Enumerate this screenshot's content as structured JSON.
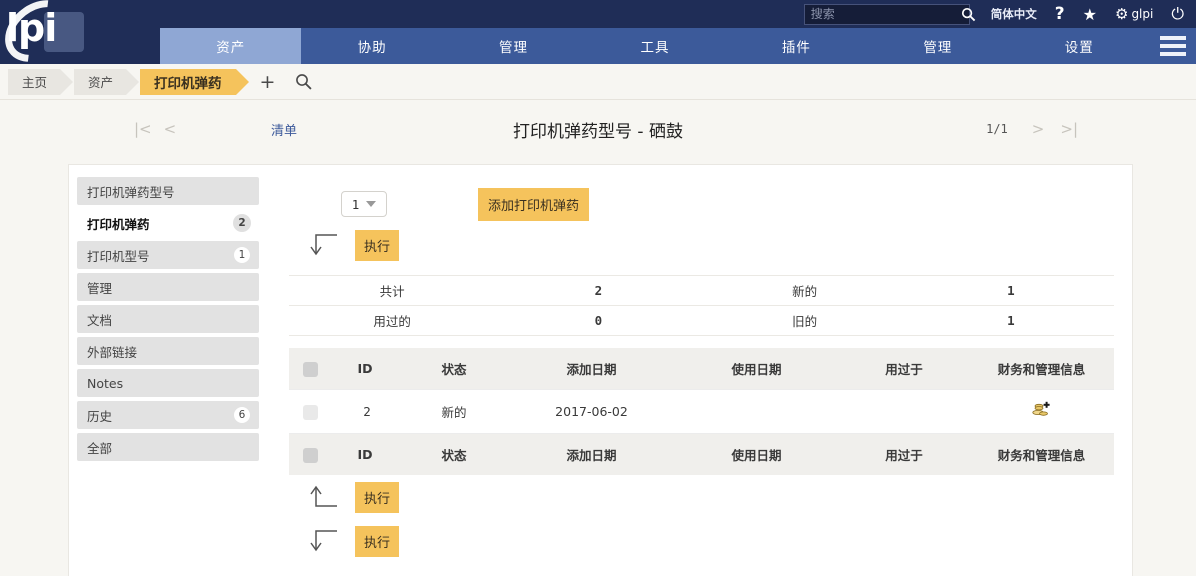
{
  "header": {
    "search_placeholder": "搜索",
    "search_value": "",
    "language": "简体中文",
    "help_label": "?",
    "star_label": "★",
    "user_label": "glpi",
    "power_label": "⏻",
    "logo_text": "lpi"
  },
  "nav": {
    "items": [
      {
        "label": "资产",
        "active": true
      },
      {
        "label": "协助",
        "active": false
      },
      {
        "label": "管理",
        "active": false
      },
      {
        "label": "工具",
        "active": false
      },
      {
        "label": "插件",
        "active": false
      },
      {
        "label": "管理",
        "active": false
      },
      {
        "label": "设置",
        "active": false
      }
    ]
  },
  "breadcrumb": {
    "items": [
      {
        "label": "主页",
        "current": false
      },
      {
        "label": "资产",
        "current": false
      },
      {
        "label": "打印机弹药",
        "current": true
      }
    ],
    "add_icon": "+",
    "search_icon": "search-icon"
  },
  "pagehead": {
    "first_icon": "|<",
    "prev_icon": "<",
    "list_label": "清单",
    "title": "打印机弹药型号 - 硒鼓",
    "counter": "1/1",
    "next_icon": ">",
    "last_icon": ">|"
  },
  "sidebar": {
    "items": [
      {
        "label": "打印机弹药型号",
        "badge": "",
        "active": false
      },
      {
        "label": "打印机弹药",
        "badge": "2",
        "active": true
      },
      {
        "label": "打印机型号",
        "badge": "1",
        "active": false
      },
      {
        "label": "管理",
        "badge": "",
        "active": false
      },
      {
        "label": "文档",
        "badge": "",
        "active": false
      },
      {
        "label": "外部链接",
        "badge": "",
        "active": false
      },
      {
        "label": "Notes",
        "badge": "",
        "active": false
      },
      {
        "label": "历史",
        "badge": "6",
        "active": false
      },
      {
        "label": "全部",
        "badge": "",
        "active": false
      }
    ]
  },
  "toolbar": {
    "count_value": "1",
    "add_label": "添加打印机弹药",
    "exec_top_label": "执行",
    "exec_bottom_up_label": "执行",
    "exec_bottom_down_label": "执行"
  },
  "stats": {
    "rows": [
      {
        "label1": "共计",
        "value1": "2",
        "label2": "新的",
        "value2": "1"
      },
      {
        "label1": "用过的",
        "value1": "0",
        "label2": "旧的",
        "value2": "1"
      }
    ]
  },
  "table": {
    "columns": [
      "ID",
      "状态",
      "添加日期",
      "使用日期",
      "用过于",
      "财务和管理信息"
    ],
    "rows": [
      {
        "id": "2",
        "state": "新的",
        "added": "2017-06-02",
        "used": "",
        "used_on": "",
        "finance_icon": "add-money-icon"
      }
    ]
  },
  "colors": {
    "accent_orange": "#f5c35c",
    "nav_blue": "#3c5a9a",
    "nav_active_blue": "#8fa7d4",
    "topbar_dark": "#1f2d57",
    "page_bg": "#f7f6f2"
  }
}
